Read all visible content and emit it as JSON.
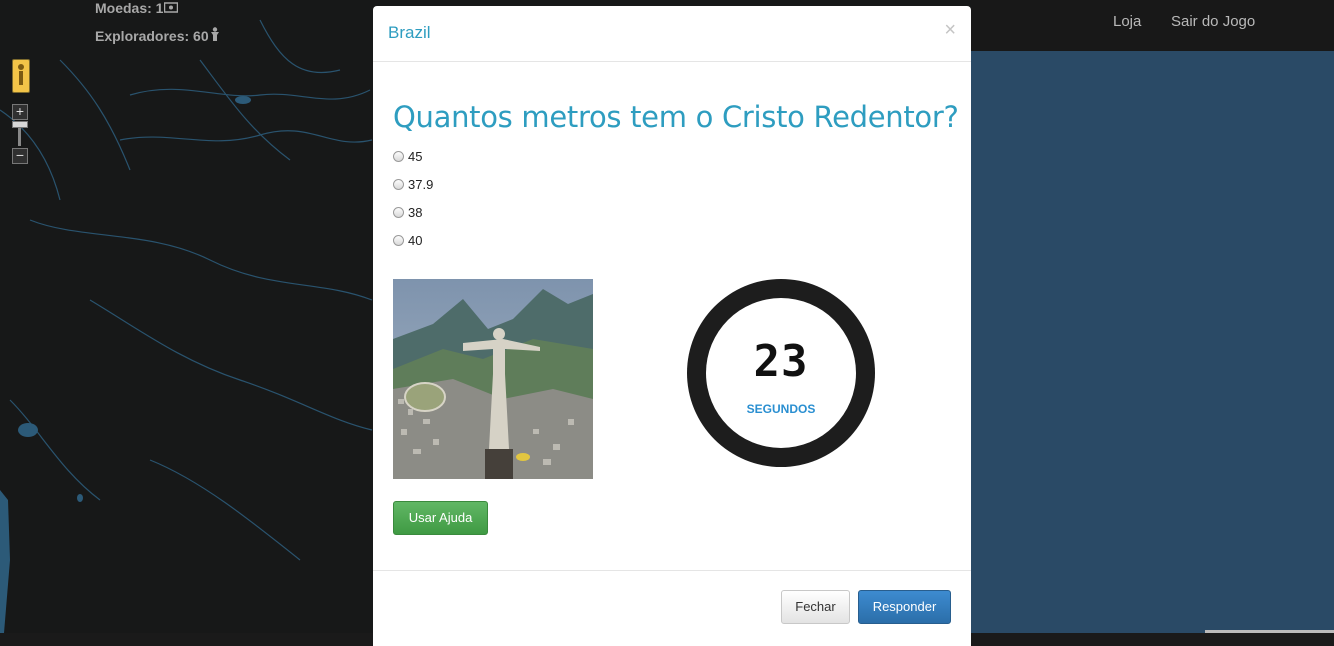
{
  "stats": {
    "coins_label": "Moedas: 1",
    "coins_icon": "banknote-icon",
    "explorers_label": "Exploradores: 60",
    "explorers_icon": "explorer-icon"
  },
  "nav": {
    "shop": "Loja",
    "exit": "Sair do Jogo"
  },
  "map_controls": {
    "zoom_in": "+",
    "zoom_out": "−"
  },
  "modal": {
    "title": "Brazil",
    "close_symbol": "×",
    "question": "Quantos metros tem o Cristo Redentor?",
    "options": [
      "45",
      "37.9",
      "38",
      "40"
    ],
    "timer": {
      "value": "23",
      "label": "SEGUNDOS"
    },
    "help_button": "Usar Ajuda",
    "close_button": "Fechar",
    "answer_button": "Responder"
  },
  "colors": {
    "accent": "#2e9dc0",
    "ocean": "#2a4a66",
    "map_land": "#171818",
    "success": "#4cae4c",
    "primary": "#337ab7"
  }
}
